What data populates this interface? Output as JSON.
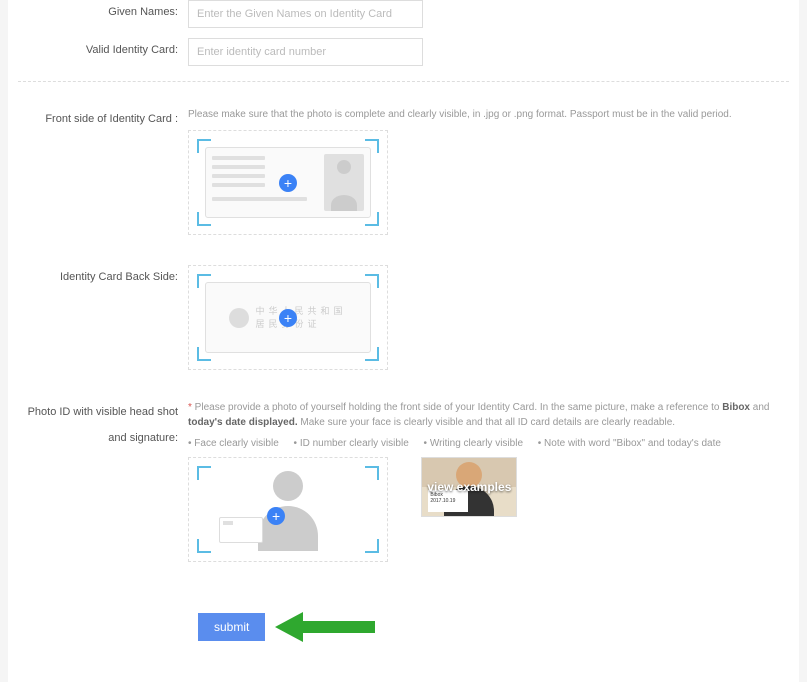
{
  "fields": {
    "given_names": {
      "label": "Given Names:",
      "placeholder": "Enter the Given Names on Identity Card"
    },
    "identity_card": {
      "label": "Valid Identity Card:",
      "placeholder": "Enter identity card number"
    }
  },
  "front": {
    "label": "Front side of Identity Card :",
    "help": "Please make sure that the photo is complete and clearly visible, in .jpg or .png format. Passport must be in the valid period."
  },
  "back": {
    "label": "Identity Card Back Side:",
    "mock_line1": "中华人民共和国",
    "mock_line2": "居民身份证"
  },
  "selfie": {
    "label_line1": "Photo ID with visible head shot",
    "label_line2": "and signature:",
    "star": "*",
    "help1": " Please provide a photo of yourself holding the front side of your Identity Card. In the same picture, make a reference to ",
    "bold1": "Bibox",
    "help2": " and ",
    "bold2": "today's date displayed.",
    "help3": " Make sure your face is clearly visible and that all ID card details are clearly readable.",
    "bullets": {
      "b1": "• Face clearly visible",
      "b2": "• ID number clearly visible",
      "b3": "• Writing clearly visible",
      "b4": "• Note with word \"Bibox\" and today's date"
    },
    "example_overlay": "view examples",
    "example_paper_line1": "Bibox",
    "example_paper_line2": "2017.10.19"
  },
  "submit_label": "submit"
}
